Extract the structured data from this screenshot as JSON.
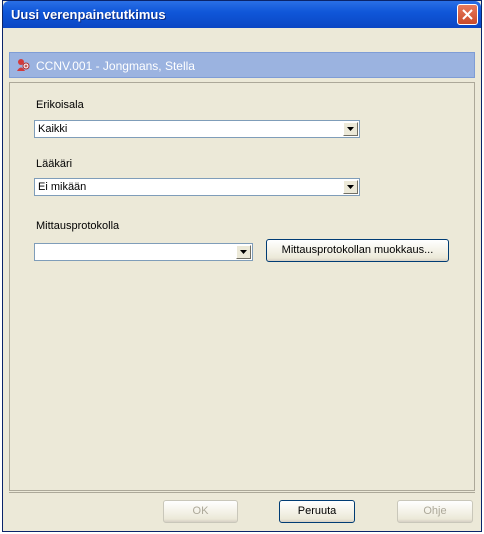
{
  "window": {
    "title": "Uusi verenpainetutkimus"
  },
  "patient": {
    "text": "CCNV.001 - Jongmans, Stella"
  },
  "form": {
    "specialty": {
      "label": "Erikoisala",
      "value": "Kaikki"
    },
    "doctor": {
      "label": "Lääkäri",
      "value": "Ei mikään"
    },
    "protocol": {
      "label": "Mittausprotokolla",
      "value": "",
      "edit_button": "Mittausprotokollan muokkaus..."
    }
  },
  "buttons": {
    "ok": "OK",
    "cancel": "Peruuta",
    "help": "Ohje"
  },
  "colors": {
    "title_bar": "#0a46c4",
    "band": "#9bb3e0",
    "dialog_bg": "#ece9d8",
    "close": "#c94a2a"
  }
}
